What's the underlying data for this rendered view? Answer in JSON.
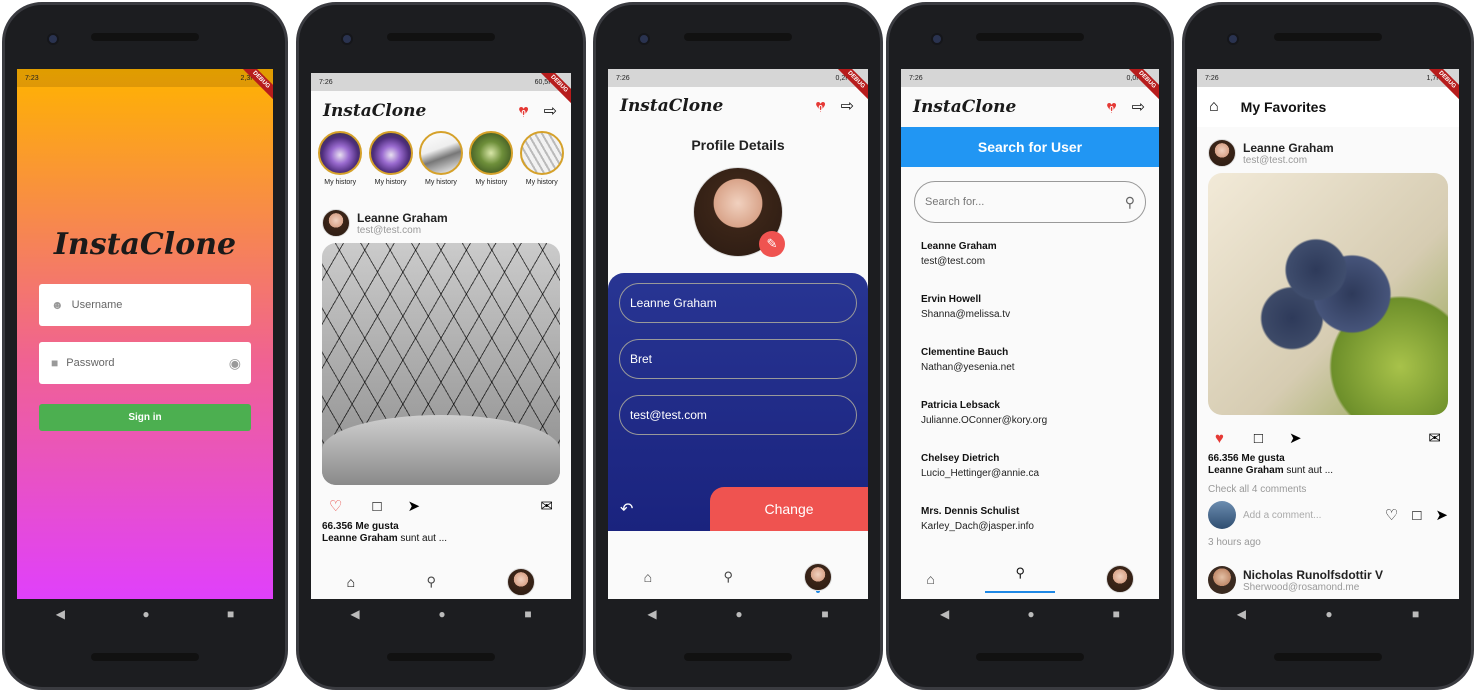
{
  "colors": {
    "primary_blue": "#2196f3",
    "navy": "#1a237e",
    "red": "#ef5350",
    "green": "#4caf50",
    "grad_top": "#ffb300",
    "grad_bottom": "#e040fb"
  },
  "screen1": {
    "status_time": "7:23",
    "status_right": "2,3KB/s",
    "logo": "InstaClone",
    "username_placeholder": "Username",
    "password_placeholder": "Password",
    "signin_label": "Sign in"
  },
  "screen2": {
    "status_time": "7:26",
    "status_right": "60,5KB/s",
    "logo": "InstaClone",
    "fav_count": "0",
    "stories": [
      "My history",
      "My history",
      "My history",
      "My history",
      "My history"
    ],
    "post_user": "Leanne Graham",
    "post_email": "test@test.com",
    "likes": "66.356 Me gusta",
    "caption_user": "Leanne Graham",
    "caption_text": "sunt aut ..."
  },
  "screen3": {
    "status_time": "7:26",
    "status_right": "0,2KB/s",
    "logo": "InstaClone",
    "fav_count": "0",
    "title": "Profile Details",
    "field_name": "Leanne Graham",
    "field_username": "Bret",
    "field_email": "test@test.com",
    "change_label": "Change"
  },
  "screen4": {
    "status_time": "7:26",
    "status_right": "0,0KB/s",
    "logo": "InstaClone",
    "fav_count": "0",
    "header": "Search for User",
    "search_placeholder": "Search for...",
    "users": [
      {
        "name": "Leanne Graham",
        "email": "test@test.com"
      },
      {
        "name": "Ervin Howell",
        "email": "Shanna@melissa.tv"
      },
      {
        "name": "Clementine Bauch",
        "email": "Nathan@yesenia.net"
      },
      {
        "name": "Patricia Lebsack",
        "email": "Julianne.OConner@kory.org"
      },
      {
        "name": "Chelsey Dietrich",
        "email": "Lucio_Hettinger@annie.ca"
      },
      {
        "name": "Mrs. Dennis Schulist",
        "email": "Karley_Dach@jasper.info"
      }
    ]
  },
  "screen5": {
    "status_time": "7:26",
    "status_right": "1,7KB/s",
    "title": "My Favorites",
    "post_user": "Leanne Graham",
    "post_email": "test@test.com",
    "likes": "66.356 Me gusta",
    "caption_user": "Leanne Graham",
    "caption_text": "sunt aut ...",
    "comments_link": "Check all 4 comments",
    "comment_placeholder": "Add a comment...",
    "time_ago": "3 hours ago",
    "next_user": "Nicholas Runolfsdottir V",
    "next_email": "Sherwood@rosamond.me"
  }
}
